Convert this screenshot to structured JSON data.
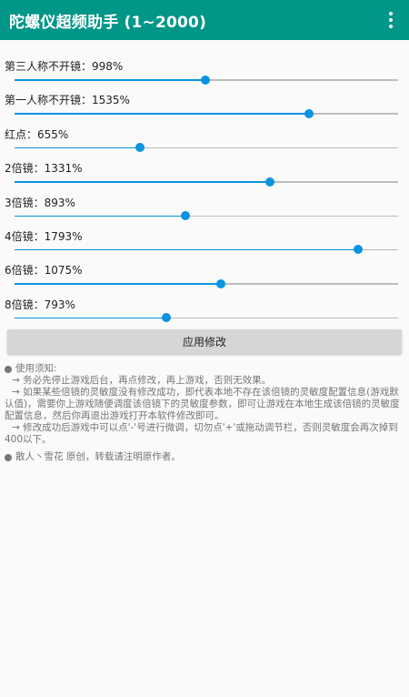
{
  "appbar": {
    "title": "陀螺仪超频助手 (1~2000)",
    "menu_icon": "more-vert-icon"
  },
  "sliders": [
    {
      "label": "第三人称不开镜：998%",
      "value": 998
    },
    {
      "label": "第一人称不开镜：1535%",
      "value": 1535
    },
    {
      "label": "红点：655%",
      "value": 655
    },
    {
      "label": "2倍镜：1331%",
      "value": 1331
    },
    {
      "label": "3倍镜：893%",
      "value": 893
    },
    {
      "label": "4倍镜：1793%",
      "value": 1793
    },
    {
      "label": "6倍镜：1075%",
      "value": 1075
    },
    {
      "label": "8倍镜：793%",
      "value": 793
    }
  ],
  "slider_range": [
    1,
    2000
  ],
  "colors": {
    "accent": "#0a93e0",
    "appbar": "#009688"
  },
  "apply_label": "应用修改",
  "notes": {
    "heading": "使用须知:",
    "lines": [
      "→ 务必先停止游戏后台，再点修改，再上游戏，否则无效果。",
      "→ 如果某些倍镜的灵敏度没有修改成功，即代表本地不存在该倍镜的灵敏度配置信息(游戏默认值)，需要你上游戏随便调度该倍镜下的灵敏度参数，即可让游戏在本地生成该倍镜的灵敏度配置信息，然后你再退出游戏打开本软件修改即可。",
      "→ 修改成功后游戏中可以点'-'号进行微调，切勿点'+'或拖动调节栏，否则灵敏度会再次掉到400以下。"
    ],
    "credit": "散人丶雪花 原创，转载请注明原作者。"
  }
}
